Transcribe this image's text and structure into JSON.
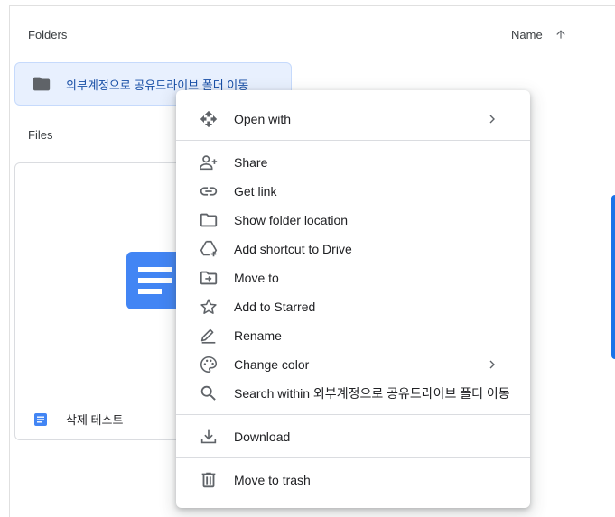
{
  "sections": {
    "folders_label": "Folders",
    "files_label": "Files"
  },
  "sort": {
    "label": "Name",
    "direction_icon": "arrow-up-icon"
  },
  "folder": {
    "name": "외부계정으로 공유드라이브 폴더 이동",
    "icon": "folder-icon"
  },
  "file": {
    "name": "삭제 테스트",
    "icon": "docs-icon",
    "thumbnail_color": "#4285f4"
  },
  "menu": {
    "items": [
      {
        "label": "Open with",
        "icon": "move-arrows-icon",
        "submenu": true
      },
      {
        "label": "Share",
        "icon": "person-add-icon"
      },
      {
        "label": "Get link",
        "icon": "link-icon"
      },
      {
        "label": "Show folder location",
        "icon": "folder-outline-icon"
      },
      {
        "label": "Add shortcut to Drive",
        "icon": "drive-add-icon"
      },
      {
        "label": "Move to",
        "icon": "folder-move-icon"
      },
      {
        "label": "Add to Starred",
        "icon": "star-icon"
      },
      {
        "label": "Rename",
        "icon": "pencil-icon"
      },
      {
        "label": "Change color",
        "icon": "palette-icon",
        "submenu": true
      },
      {
        "label": "Search within 외부계정으로 공유드라이브 폴더 이동",
        "icon": "search-icon"
      },
      {
        "label": "Download",
        "icon": "download-icon"
      },
      {
        "label": "Move to trash",
        "icon": "trash-icon"
      }
    ]
  },
  "colors": {
    "accent": "#1a73e8",
    "selected_bg": "#e8f0fe",
    "icon_gray": "#5f6368",
    "text": "#202124"
  }
}
